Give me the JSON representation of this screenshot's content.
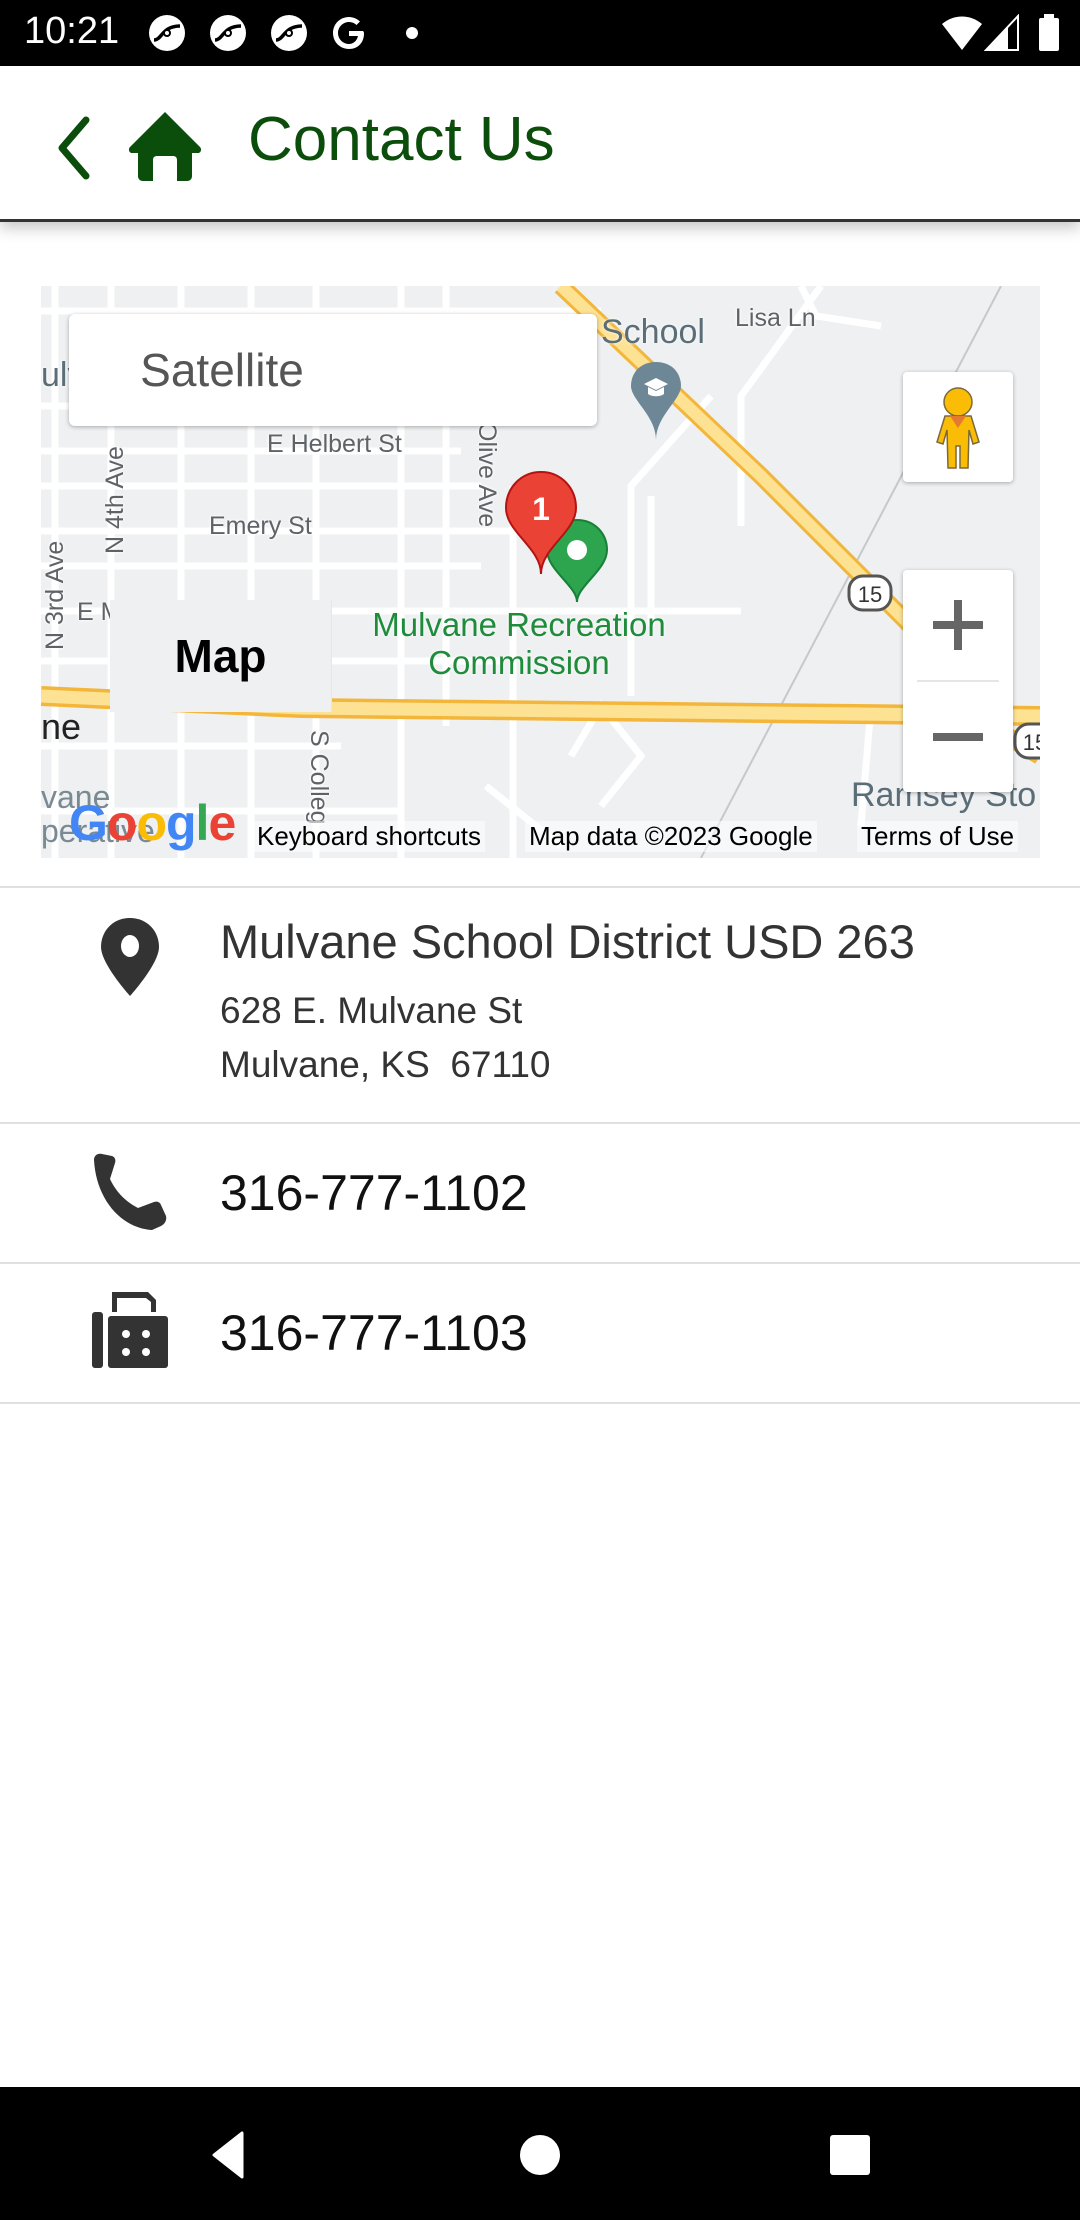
{
  "status_bar": {
    "time": "10:21",
    "notification_icons": [
      "sync-app-icon",
      "sync-app-icon",
      "sync-app-icon",
      "google-icon",
      "more-dot-icon"
    ],
    "system_icons": [
      "wifi-icon",
      "cellular-signal-icon",
      "battery-icon"
    ]
  },
  "app_bar": {
    "title": "Contact Us",
    "back_icon": "chevron-left-icon",
    "home_icon": "home-icon",
    "accent_color": "#0b4d0b"
  },
  "map": {
    "map_type": {
      "options": [
        "Map",
        "Satellite"
      ],
      "selected": "Map"
    },
    "labels": {
      "school": "School",
      "lisa_ln": "Lisa Ln",
      "e_helbert_st": "E Helbert St",
      "olive_ave": "Olive Ave",
      "emery_st": "Emery St",
      "n_4th_ave": "N 4th Ave",
      "n_3rd_ave": "N 3rd Ave",
      "e_mulvane_st": "E Mulvane St",
      "poi_name_line1": "Mulvane Recreation",
      "poi_name_line2": "Commission",
      "s_college": "S Colleg",
      "route_15": "15",
      "route_15b": "15",
      "ramsey": "Ramsey Sto",
      "city_fragment": "ne",
      "city_fragment2_line1": "vane",
      "city_fragment2_line2": "perative",
      "left_fragment": "ulv"
    },
    "marker_label": "1",
    "marker_color": "#ea4335",
    "poi_color": "#1e8c3a",
    "google_logo": "Google",
    "footer": {
      "keyboard_shortcuts": "Keyboard shortcuts",
      "map_data": "Map data ©2023 Google",
      "terms": "Terms of Use"
    }
  },
  "contact": {
    "address": {
      "name": "Mulvane School District USD 263",
      "line1": "628 E. Mulvane St",
      "line2": "Mulvane, KS  67110"
    },
    "phone": "316-777-1102",
    "fax": "316-777-1103"
  },
  "nav_bar": {
    "buttons": [
      "back",
      "home",
      "recents"
    ]
  }
}
